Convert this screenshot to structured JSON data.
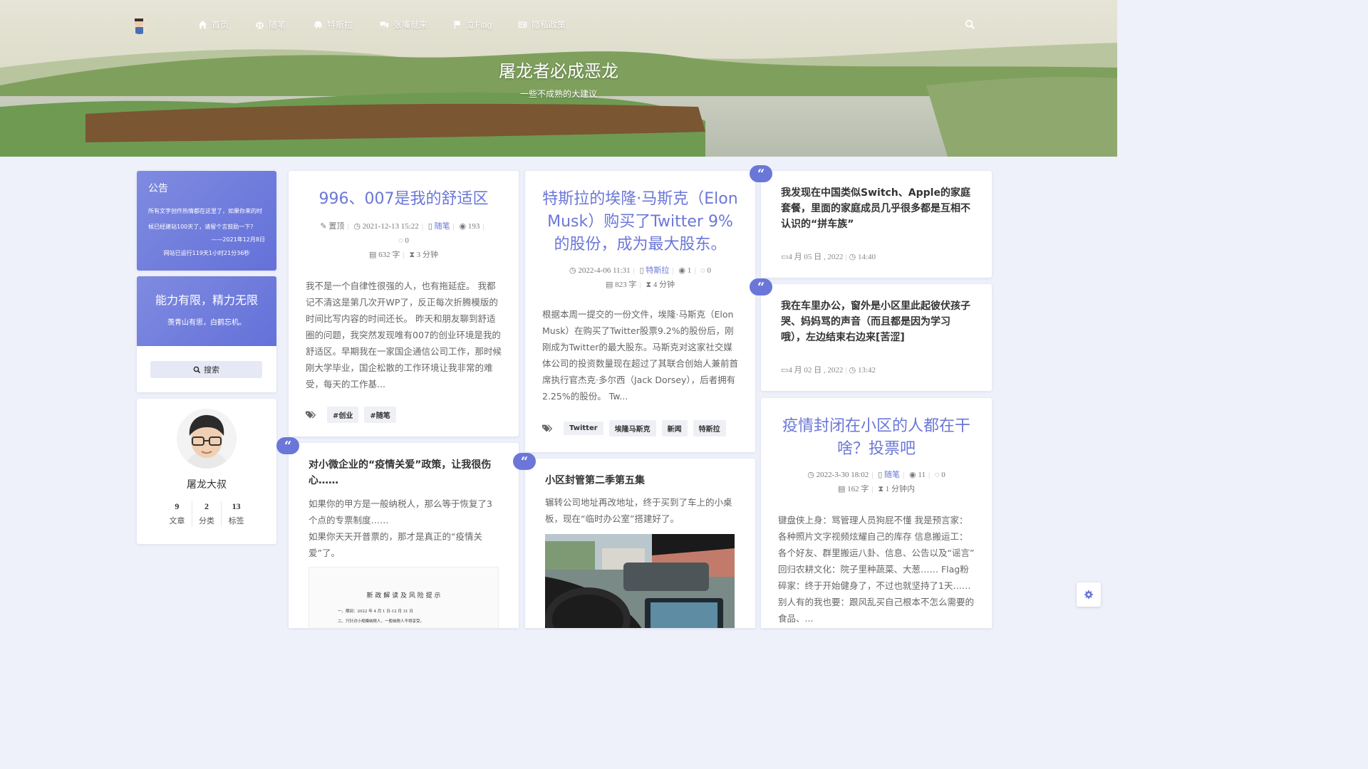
{
  "nav": {
    "items": [
      {
        "label": "首页",
        "icon": "home-icon"
      },
      {
        "label": "随笔",
        "icon": "scale-icon"
      },
      {
        "label": "特斯拉",
        "icon": "car-icon"
      },
      {
        "label": "张嘴就来",
        "icon": "comments-icon"
      },
      {
        "label": "立Flag",
        "icon": "flag-icon"
      },
      {
        "label": "隐私政策",
        "icon": "id-card-icon"
      }
    ]
  },
  "hero": {
    "title": "屠龙者必成恶龙",
    "subtitle": "一些不成熟的大建议"
  },
  "sidebar": {
    "notice": {
      "title": "公告",
      "body": "所有文字创作热情都在这里了，如果你来的时候已经建站100天了，请留个言鼓励一下?",
      "signature": "——2021年12月8日",
      "runtime": "网站已运行119天1小时21分36秒"
    },
    "motto": {
      "title": "能力有限，精力无限",
      "subtitle": "羡青山有思，白鹤忘机。"
    },
    "search_label": "搜索",
    "profile": {
      "name": "屠龙大叔",
      "stats": [
        {
          "num": "9",
          "label": "文章"
        },
        {
          "num": "2",
          "label": "分类"
        },
        {
          "num": "13",
          "label": "标签"
        }
      ]
    }
  },
  "posts": {
    "p1": {
      "title": "996、007是我的舒适区",
      "pinned": "置顶",
      "date": "2021-12-13 15:22",
      "category": "随笔",
      "views": "193",
      "comments": "0",
      "words": "632 字",
      "read": "3 分钟",
      "excerpt": "我不是一个自律性很强的人，也有拖延症。 我都记不清这是第几次开WP了，反正每次折腾模版的时间比写内容的时间还长。 昨天和朋友聊到舒适圈的问题，我突然发现唯有007的创业环境是我的舒适区。早期我在一家国企通信公司工作，那时候刚大学毕业，国企松散的工作环境让我非常的难受，每天的工作基...",
      "tags": [
        "#创业",
        "#随笔"
      ]
    },
    "p2": {
      "title": "特斯拉的埃隆·马斯克（Elon Musk）购买了Twitter 9%的股份，成为最大股东。",
      "date": "2022-4-06 11:31",
      "category": "特斯拉",
      "views": "1",
      "comments": "0",
      "words": "823 字",
      "read": "4 分钟",
      "excerpt": "根据本周一提交的一份文件，埃隆·马斯克（Elon Musk）在购买了Twitter股票9.2%的股份后，刚刚成为Twitter的最大股东。马斯克对这家社交媒体公司的投资数量现在超过了其联合创始人兼前首席执行官杰克·多尔西（Jack Dorsey），后者拥有2.25%的股份。 Tw...",
      "tags": [
        "Twitter",
        "埃隆马斯克",
        "新闻",
        "特斯拉"
      ]
    },
    "q1": {
      "title": "我发现在中国类似Switch、Apple的家庭套餐，里面的家庭成员几乎很多都是互相不认识的“拼车族”",
      "date": "4 月 05 日 , 2022",
      "time": "14:40"
    },
    "q2": {
      "title": "我在车里办公，窗外是小区里此起彼伏孩子哭、妈妈骂的声音（而且都是因为学习哦），左边结束右边来[苦涩]",
      "date": "4 月 02 日 , 2022",
      "time": "13:42"
    },
    "p3": {
      "title": "疫情封闭在小区的人都在干啥？投票吧",
      "date": "2022-3-30 18:02",
      "category": "随笔",
      "views": "11",
      "comments": "0",
      "words": "162 字",
      "read": "1 分钟内",
      "excerpt": "键盘侠上身：骂管理人员狗屁不懂 我是预言家：各种照片文字视频炫耀自己的库存 信息搬运工：各个好友、群里搬运八卦、信息、公告以及“谣言” 回归农耕文化：院子里种蔬菜、大葱…… Flag粉碎家：终于开始健身了，不过也就坚持了1天…… 别人有的我也要：跟风乱买自己根本不怎么需要的食品、..."
    },
    "q3": {
      "title": "对小微企业的“疫情关爱”政策，让我很伤心……",
      "line1": "如果你的甲方是一般纳税人，那么等于恢复了3个点的专票制度……",
      "line2": "如果你天天开普票的，那才是真正的“疫情关爱”了。",
      "doc_title": "新 政 解 读 及 风 险 提 示",
      "doc_line1": "一、期间：2022 年 4 月 1 日-12 月 31 日",
      "doc_line2": "二、只针对小规模纳税人，一般纳税人不得享受。"
    },
    "q4": {
      "title": "小区封管第二季第五集",
      "body": "辗转公司地址再改地址，终于买到了车上的小桌板，现在“临时办公室”搭建好了。"
    }
  },
  "colors": {
    "accent": "#6b77d8",
    "background": "#eef1fa"
  }
}
